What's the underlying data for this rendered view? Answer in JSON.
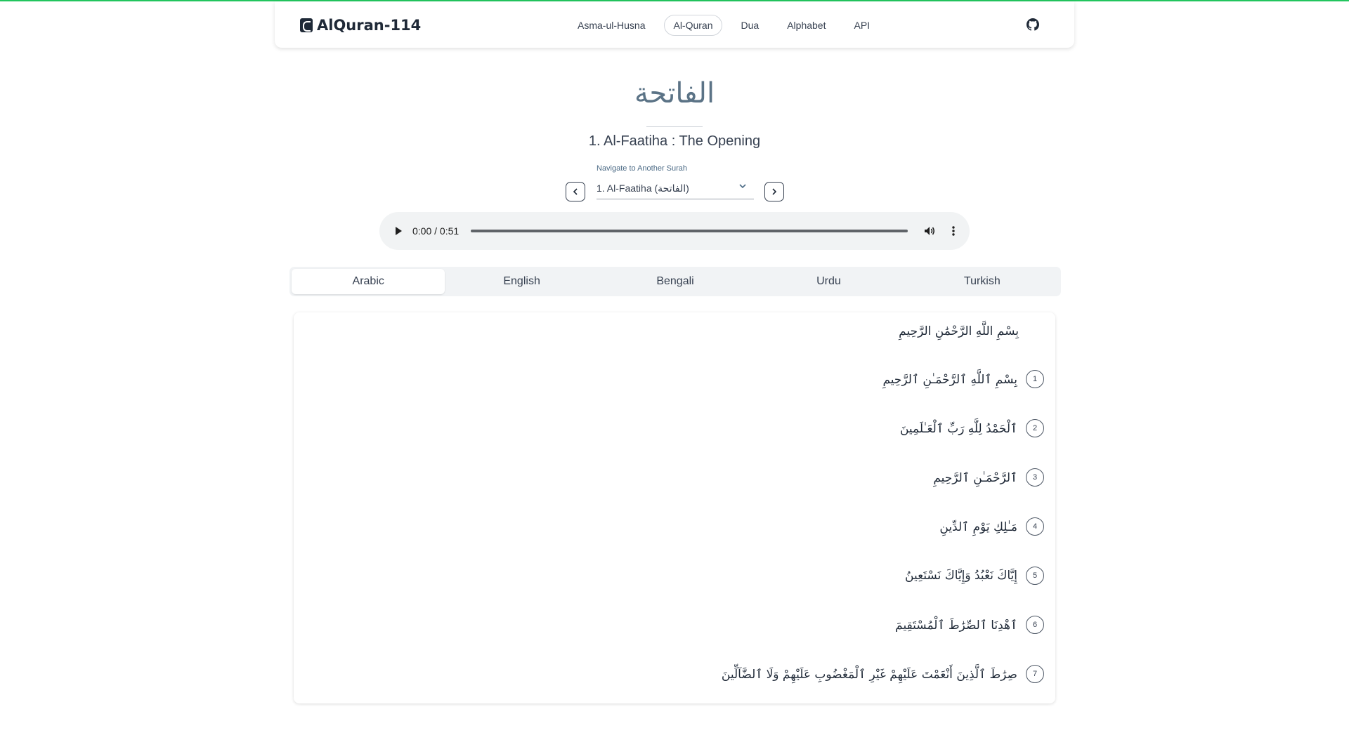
{
  "brand": {
    "name": "AlQuran-114"
  },
  "nav": {
    "links": [
      "Asma-ul-Husna",
      "Al-Quran",
      "Dua",
      "Alphabet",
      "API"
    ],
    "active": "Al-Quran"
  },
  "surah": {
    "arabic_name": "الفاتحة",
    "title": "1. Al-Faatiha : The Opening"
  },
  "navigator": {
    "label": "Navigate to Another Surah",
    "selected": "1. Al-Faatiha (الفاتحة)"
  },
  "audio": {
    "time": "0:00 / 0:51"
  },
  "tabs": [
    "Arabic",
    "English",
    "Bengali",
    "Urdu",
    "Turkish"
  ],
  "active_tab": "Arabic",
  "bismillah": "بِسْمِ اللَّهِ الرَّحْمَٰنِ الرَّحِيمِ",
  "verses": [
    {
      "number": "1",
      "text": "بِسْمِ ٱللَّهِ ٱلرَّحْمَـٰنِ ٱلرَّحِيمِ"
    },
    {
      "number": "2",
      "text": "ٱلْحَمْدُ لِلَّهِ رَبِّ ٱلْعَـٰلَمِينَ"
    },
    {
      "number": "3",
      "text": "ٱلرَّحْمَـٰنِ ٱلرَّحِيمِ"
    },
    {
      "number": "4",
      "text": "مَـٰلِكِ يَوْمِ ٱلدِّينِ"
    },
    {
      "number": "5",
      "text": "إِيَّاكَ نَعْبُدُ وَإِيَّاكَ نَسْتَعِينُ"
    },
    {
      "number": "6",
      "text": "ٱهْدِنَا ٱلصِّرَٰطَ ٱلْمُسْتَقِيمَ"
    },
    {
      "number": "7",
      "text": "صِرَٰطَ ٱلَّذِينَ أَنْعَمْتَ عَلَيْهِمْ غَيْرِ ٱلْمَغْضُوبِ عَلَيْهِمْ وَلَا ٱلضَّآلِّينَ"
    }
  ],
  "colors": {
    "accent": "#22c55e",
    "title": "#5b7386"
  }
}
